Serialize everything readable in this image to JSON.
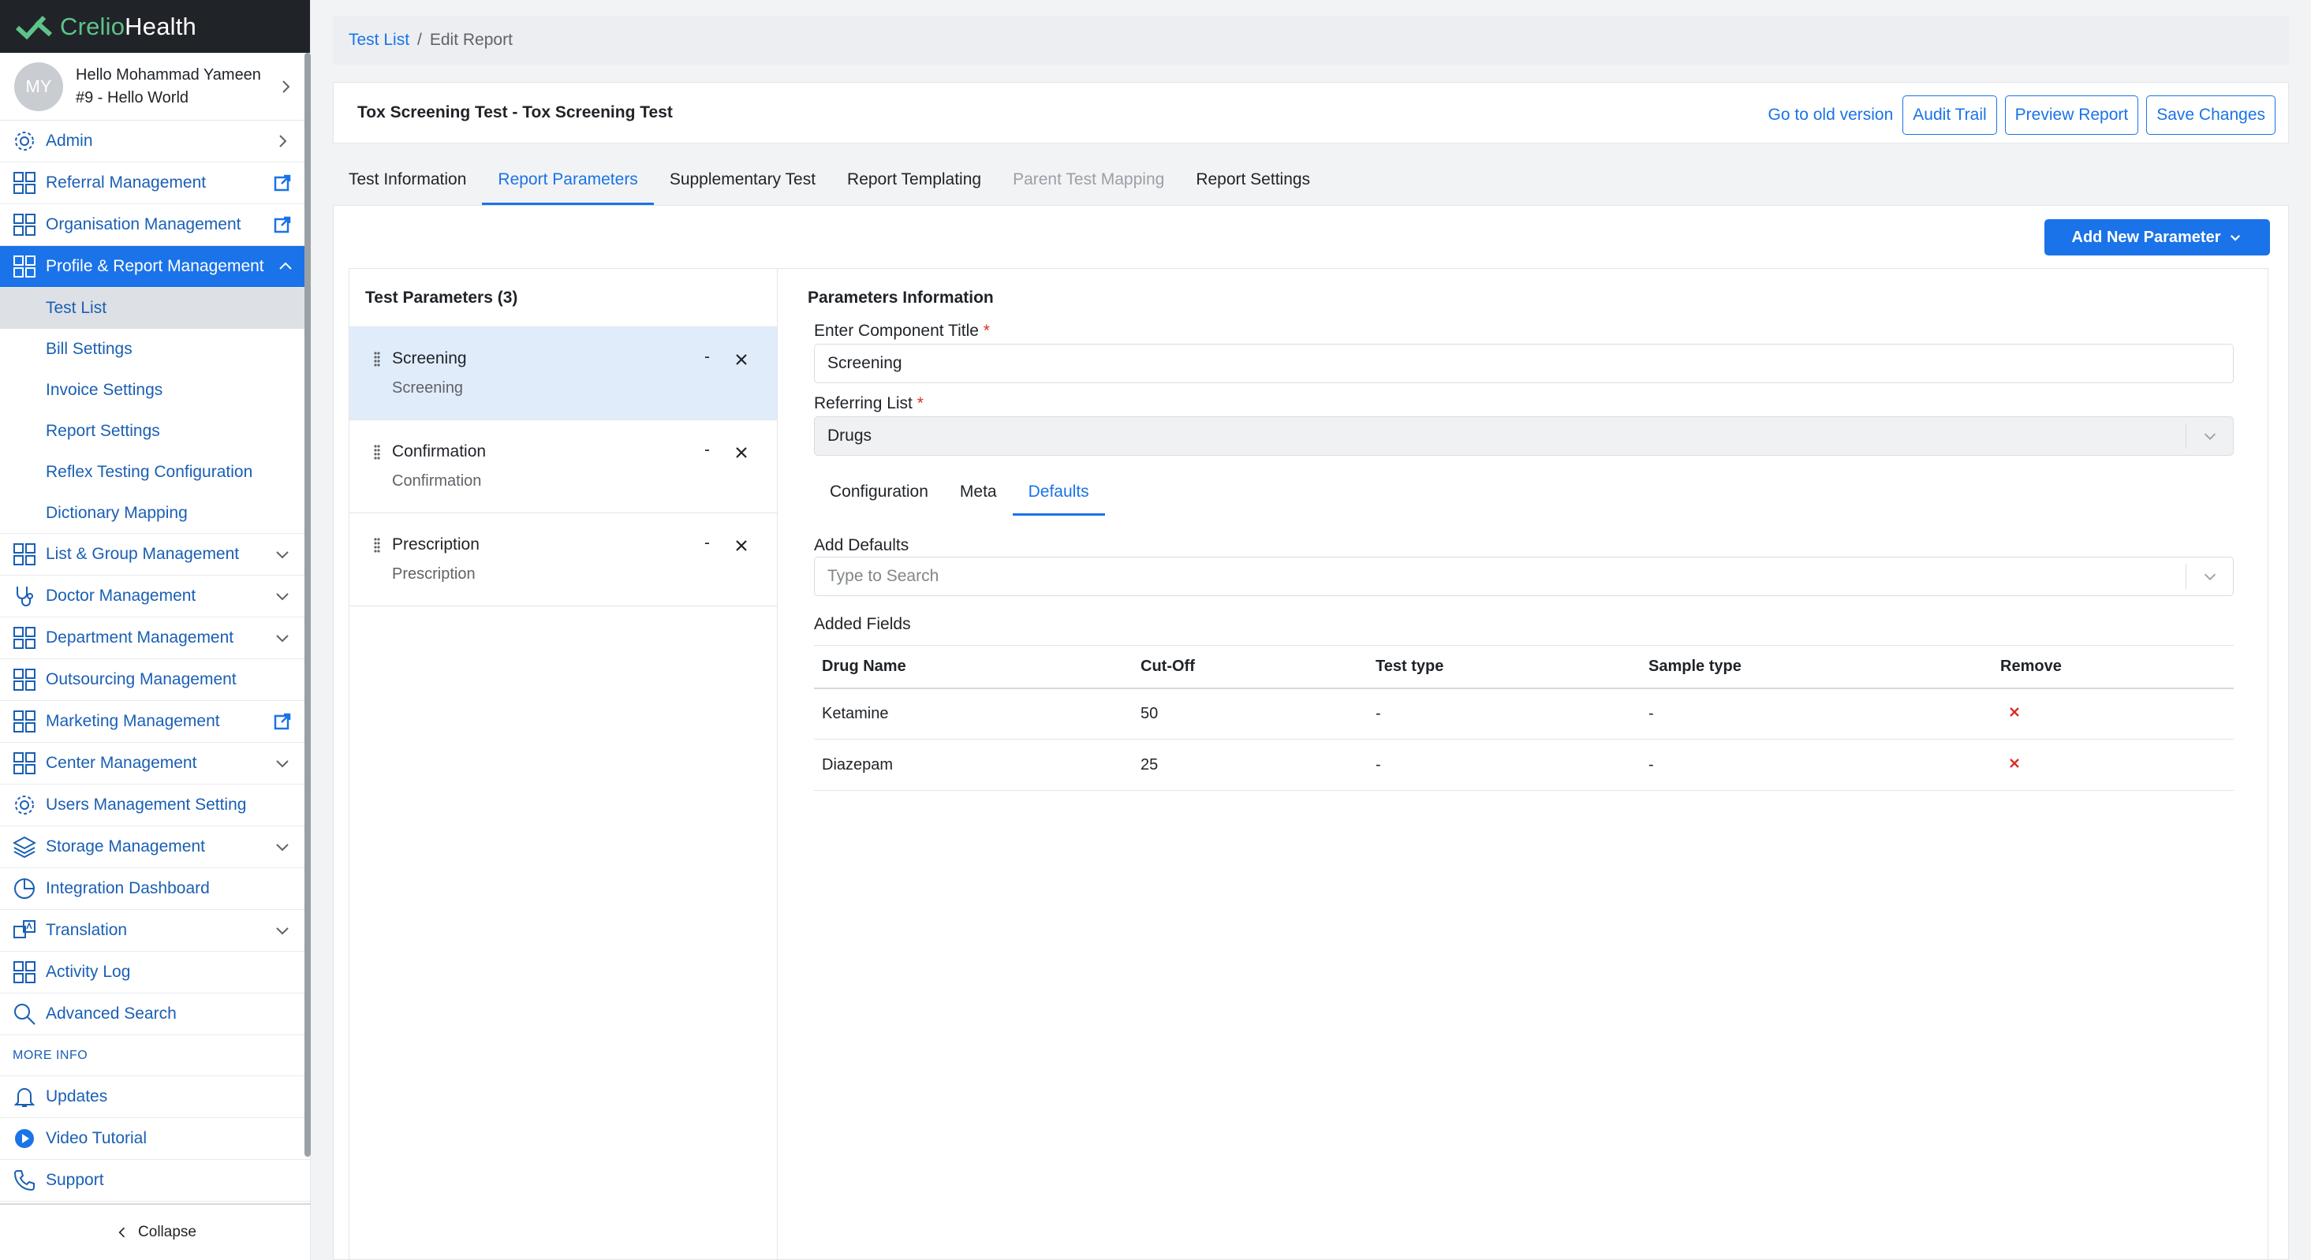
{
  "brand": {
    "part1": "Crelio",
    "part2": "Health"
  },
  "user": {
    "initials": "MY",
    "greeting": "Hello Mohammad Yameen",
    "org": "#9 - Hello World"
  },
  "sidebar": {
    "items": [
      {
        "label": "Admin",
        "icon": "gear-icon"
      },
      {
        "label": "Referral Management",
        "icon": "grid-icon"
      },
      {
        "label": "Organisation Management",
        "icon": "grid-icon"
      },
      {
        "label": "Profile & Report Management",
        "icon": "grid-icon"
      },
      {
        "label": "List & Group Management",
        "icon": "grid-icon"
      },
      {
        "label": "Doctor Management",
        "icon": "stethoscope-icon"
      },
      {
        "label": "Department Management",
        "icon": "grid-icon"
      },
      {
        "label": "Outsourcing Management",
        "icon": "grid-icon"
      },
      {
        "label": "Marketing Management",
        "icon": "grid-icon"
      },
      {
        "label": "Center Management",
        "icon": "grid-icon"
      },
      {
        "label": "Users Management Setting",
        "icon": "gear-icon"
      },
      {
        "label": "Storage Management",
        "icon": "layers-icon"
      },
      {
        "label": "Integration Dashboard",
        "icon": "pie-chart-icon"
      },
      {
        "label": "Translation",
        "icon": "translate-icon"
      },
      {
        "label": "Activity Log",
        "icon": "grid-icon"
      },
      {
        "label": "Advanced Search",
        "icon": "search-icon"
      }
    ],
    "subitems": [
      "Test List",
      "Bill Settings",
      "Invoice Settings",
      "Report Settings",
      "Reflex Testing Configuration",
      "Dictionary Mapping"
    ],
    "more_info": "MORE INFO",
    "more_items": [
      {
        "label": "Updates",
        "icon": "bell-icon"
      },
      {
        "label": "Video Tutorial",
        "icon": "play-icon"
      },
      {
        "label": "Support",
        "icon": "phone-icon"
      }
    ],
    "collapse": "Collapse"
  },
  "breadcrumb": {
    "link": "Test List",
    "separator": "/",
    "current": "Edit Report"
  },
  "header": {
    "title": "Tox Screening Test - Tox Screening Test",
    "old_version": "Go to old version",
    "audit": "Audit Trail",
    "preview": "Preview Report",
    "save": "Save Changes"
  },
  "tabs": [
    "Test Information",
    "Report Parameters",
    "Supplementary Test",
    "Report Templating",
    "Parent Test Mapping",
    "Report Settings"
  ],
  "add_param": "Add New Parameter",
  "left": {
    "heading": "Test Parameters (3)",
    "params": [
      {
        "name": "Screening",
        "sub": "Screening"
      },
      {
        "name": "Confirmation",
        "sub": "Confirmation"
      },
      {
        "name": "Prescription",
        "sub": "Prescription"
      }
    ],
    "dash": "-"
  },
  "right": {
    "heading": "Parameters Information",
    "component_label": "Enter Component Title",
    "component_value": "Screening",
    "referring_label": "Referring List",
    "referring_value": "Drugs",
    "required_mark": "*",
    "subtabs": [
      "Configuration",
      "Meta",
      "Defaults"
    ],
    "add_defaults_label": "Add Defaults",
    "search_placeholder": "Type to Search",
    "added_fields": "Added Fields",
    "table": {
      "headers": [
        "Drug Name",
        "Cut-Off",
        "Test type",
        "Sample type",
        "Remove"
      ],
      "rows": [
        [
          "Ketamine",
          "50",
          "-",
          "-"
        ],
        [
          "Diazepam",
          "25",
          "-",
          "-"
        ]
      ]
    }
  },
  "colors": {
    "accent": "#1a73e8",
    "brand_green": "#5ec38a",
    "danger": "#d93025"
  }
}
